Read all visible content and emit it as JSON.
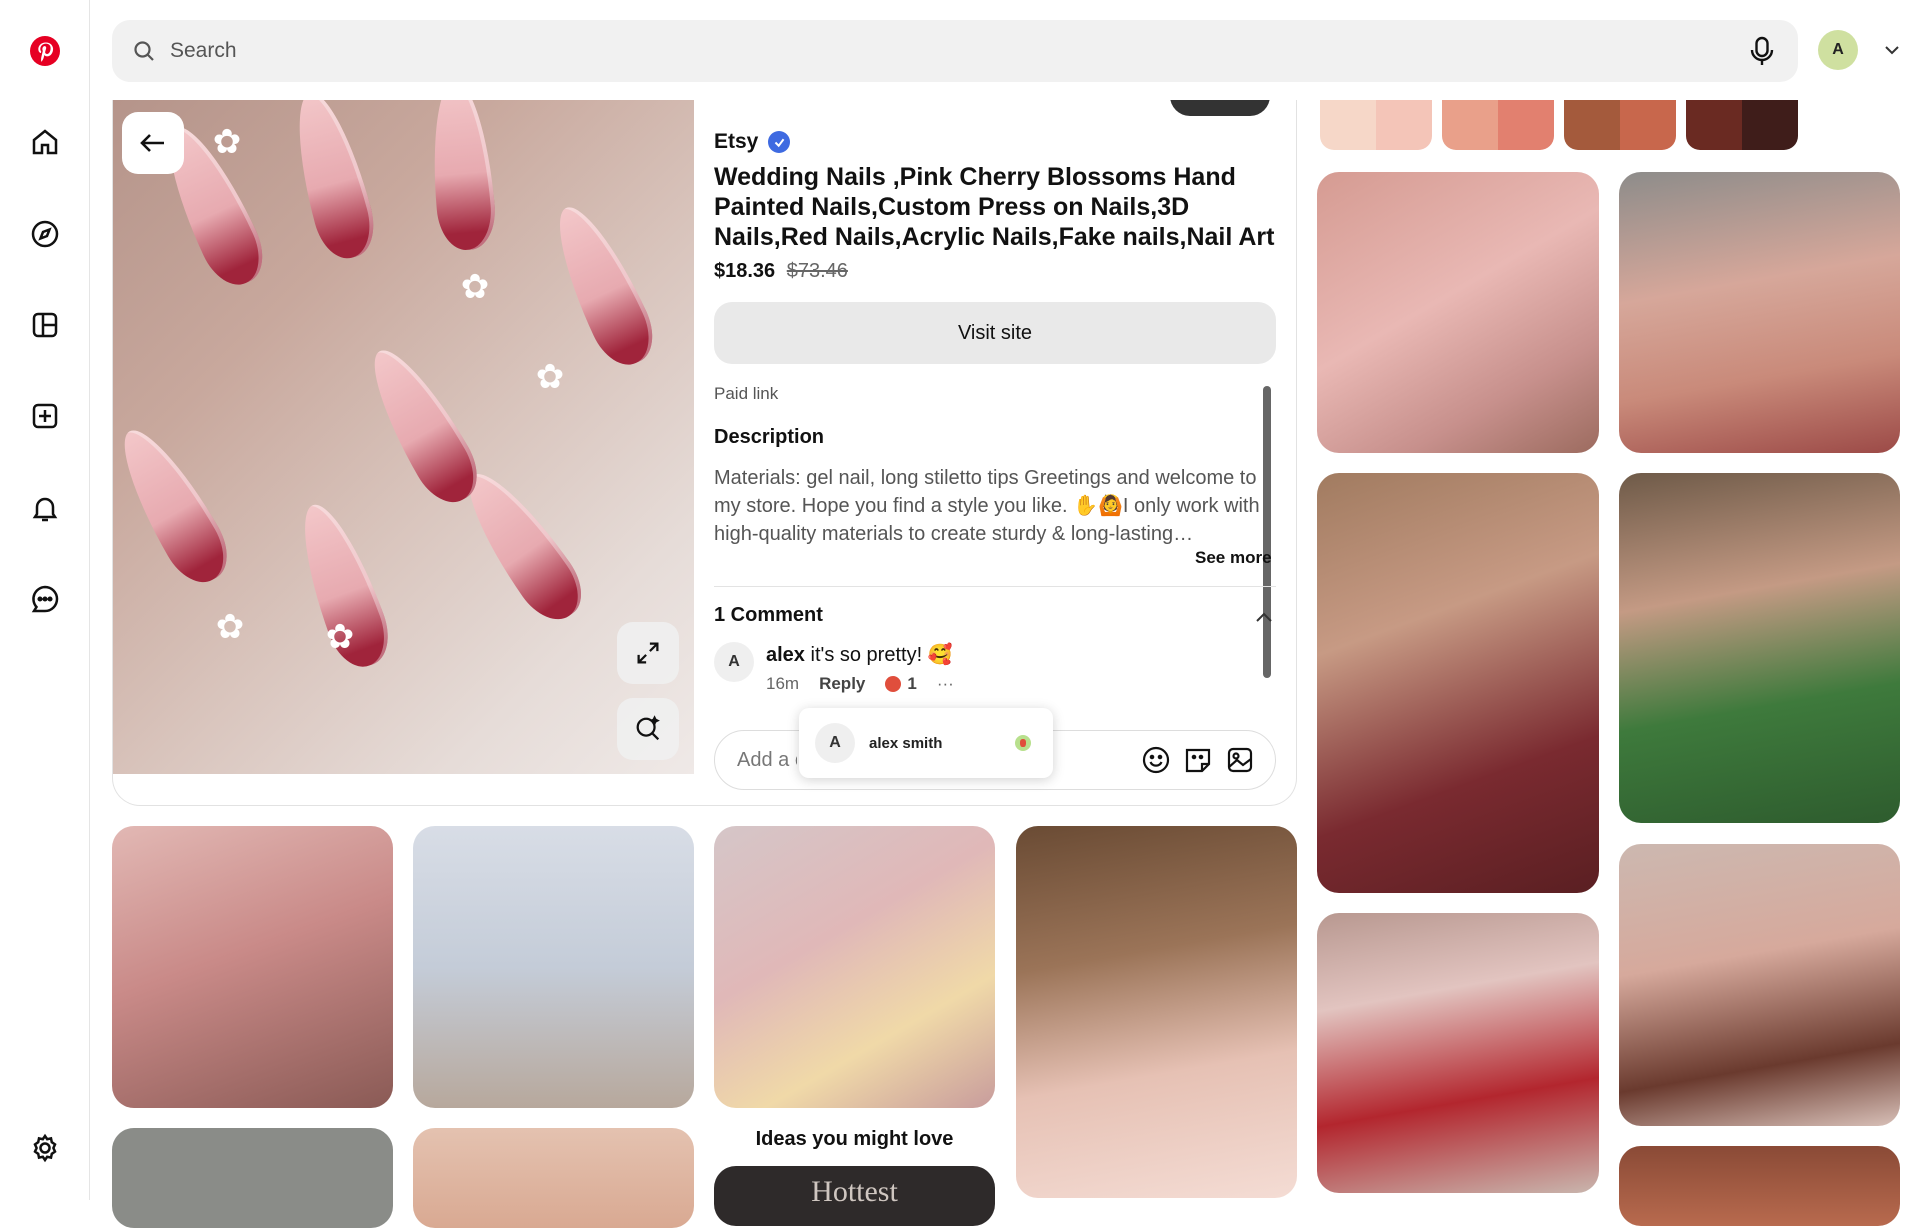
{
  "search": {
    "placeholder": "Search"
  },
  "user": {
    "initial": "A"
  },
  "pin": {
    "merchant": "Etsy",
    "title": "Wedding Nails ,Pink Cherry Blossoms Hand Painted Nails,Custom Press on Nails,3D Nails,Red Nails,Acrylic Nails,Fake nails,Nail Art",
    "price": "$18.36",
    "original_price": "$73.46",
    "visit_label": "Visit site",
    "paid_label": "Paid link",
    "description_heading": "Description",
    "description_text": "Materials: gel nail, long stiletto tips Greetings and welcome to my store. Hope you find a style you like. ✋🙆I only work with high-quality materials to create sturdy & long-lasting…",
    "see_more": "See more"
  },
  "comments": {
    "heading": "1 Comment",
    "items": [
      {
        "initial": "A",
        "author": "alex",
        "text": "it's so pretty! 🥰",
        "time": "16m",
        "reply_label": "Reply",
        "reactions": "1",
        "more": "···"
      }
    ],
    "input_placeholder": "Add a comment",
    "mention": {
      "initial": "A",
      "name": "alex smith"
    }
  },
  "ideas_label": "Ideas you might love",
  "teaser_text": "Hottest",
  "colors": {
    "accent_red": "#e60023",
    "verified_blue": "#3e6ae1",
    "search_bg": "#f1f1f1"
  },
  "icons": [
    "pinterest-logo-icon",
    "home-icon",
    "explore-icon",
    "boards-icon",
    "create-icon",
    "notifications-icon",
    "messages-icon",
    "settings-icon",
    "search-icon",
    "microphone-icon",
    "chevron-down-icon",
    "back-arrow-icon",
    "expand-icon",
    "visual-search-icon",
    "emoji-icon",
    "sticker-icon",
    "image-icon",
    "chevron-up-icon"
  ]
}
